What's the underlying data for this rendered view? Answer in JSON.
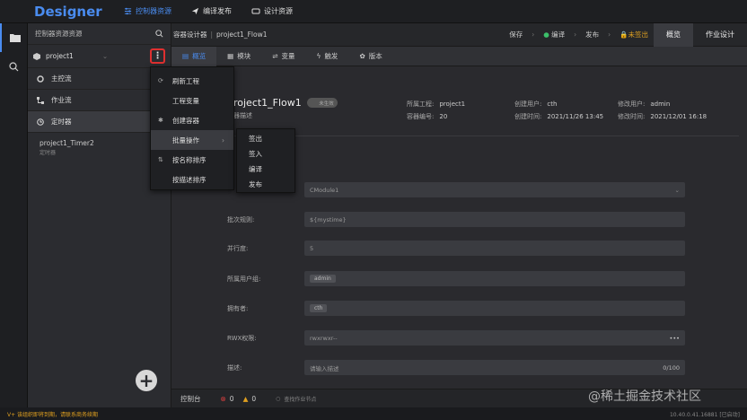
{
  "app": {
    "brand": "Designer"
  },
  "topnav": [
    {
      "label": "控制器资源",
      "icon": "sliders-icon",
      "active": true
    },
    {
      "label": "编译发布",
      "icon": "send-icon",
      "active": false
    },
    {
      "label": "设计资源",
      "icon": "cloud-icon",
      "active": false
    }
  ],
  "sidebar": {
    "header": "控制器资源资源",
    "project": "project1",
    "items": [
      {
        "label": "主控流"
      },
      {
        "label": "作业流"
      },
      {
        "label": "定时器"
      }
    ],
    "timer": {
      "name": "project1_Timer2",
      "sub": "定时器"
    }
  },
  "breadcrumb": {
    "root": "容器设计器",
    "current": "project1_Flow1"
  },
  "actions": {
    "save": "保存",
    "compile": "编译",
    "publish": "发布",
    "status": "未签出",
    "tab_overview": "概览",
    "tab_design": "作业设计"
  },
  "subtabs": [
    {
      "label": "概览",
      "active": true
    },
    {
      "label": "模块"
    },
    {
      "label": "变量"
    },
    {
      "label": "触发"
    },
    {
      "label": "版本"
    }
  ],
  "overview": {
    "title": "project1_Flow1",
    "toggle": "未生效",
    "desc_label": "容器描述",
    "meta": {
      "project_label": "所属工程:",
      "project": "project1",
      "creator_label": "创建用户:",
      "creator": "cth",
      "modifier_label": "修改用户:",
      "modifier": "admin",
      "code_label": "容器编号:",
      "code": "20",
      "ctime_label": "创建时间:",
      "ctime": "2021/11/26 13:45",
      "mtime_label": "修改时间:",
      "mtime": "2021/12/01 16:18"
    }
  },
  "form": {
    "module_value": "CModule1",
    "batch_label": "批次规则:",
    "batch_value": "${mystime}",
    "parallel_label": "并行度:",
    "parallel_value": "5",
    "group_label": "所属用户组:",
    "group_value": "admin",
    "owner_label": "拥有者:",
    "owner_value": "cth",
    "rwx_label": "RWX权限:",
    "rwx_value": "rwxrwxr--",
    "desc_label": "描述:",
    "desc_placeholder": "请输入描述",
    "desc_count": "0/100"
  },
  "context_menu": {
    "items": [
      {
        "label": "刷新工程",
        "icon": "refresh-icon"
      },
      {
        "label": "工程变量",
        "icon": ""
      },
      {
        "label": "创建容器",
        "icon": "create-icon"
      },
      {
        "label": "批量操作",
        "icon": "",
        "has_sub": true
      },
      {
        "label": "按名称排序",
        "icon": "sort-icon"
      },
      {
        "label": "按描述排序",
        "icon": ""
      }
    ]
  },
  "submenu": {
    "items": [
      {
        "label": "签出"
      },
      {
        "label": "签入"
      },
      {
        "label": "编译"
      },
      {
        "label": "发布"
      }
    ]
  },
  "bottombar": {
    "console": "控制台",
    "errors": "0",
    "warnings": "0",
    "search_placeholder": "查找作业节点"
  },
  "statusbar": {
    "notice": "V+ 该组织即将到期，请联系商务续期",
    "version": "10.40.0.41.16881 [已启动]"
  },
  "watermark": "@稀土掘金技术社区",
  "colors": {
    "accent": "#4a8cf0",
    "warning": "#e0a020",
    "highlight_border": "#e03030"
  }
}
